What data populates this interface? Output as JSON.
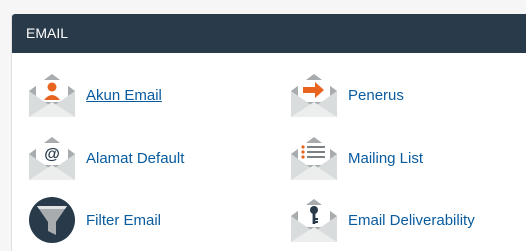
{
  "section": {
    "title": "EMAIL"
  },
  "items": [
    {
      "label": "Akun Email",
      "icon": "email-accounts-icon"
    },
    {
      "label": "Penerus",
      "icon": "forwarders-icon"
    },
    {
      "label": "Alamat Default",
      "icon": "default-address-icon"
    },
    {
      "label": "Mailing List",
      "icon": "mailing-list-icon"
    },
    {
      "label": "Filter Email",
      "icon": "email-filter-icon"
    },
    {
      "label": "Email Deliverability",
      "icon": "email-deliverability-icon"
    }
  ],
  "colors": {
    "header_bg": "#293a4a",
    "link": "#095b9f",
    "accent_orange": "#e8641f",
    "envelope_gray": "#a8acae",
    "funnel_navy": "#293a4a"
  }
}
